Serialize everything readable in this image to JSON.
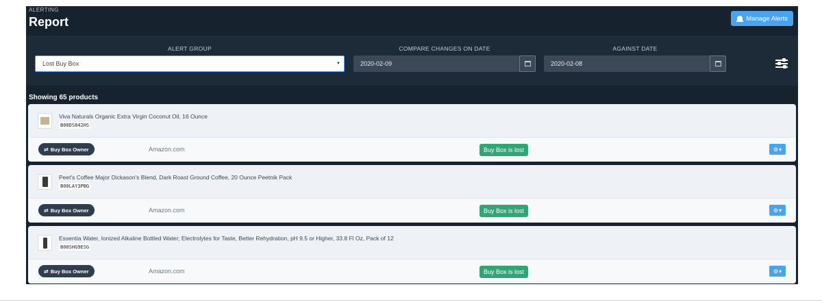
{
  "header": {
    "kicker": "ALERTING",
    "title": "Report",
    "manage_label": "Manage Alerts"
  },
  "filters": {
    "alert_group_label": "ALERT GROUP",
    "alert_group_value": "Lost Buy Box",
    "compare_label": "COMPARE CHANGES ON DATE",
    "compare_value": "2020-02-09",
    "against_label": "AGAINST DATE",
    "against_value": "2020-02-08"
  },
  "summary": {
    "showing": "Showing 65 products"
  },
  "products": [
    {
      "name": "Viva Naturals Organic Extra Virgin Coconut Oil, 16 Ounce",
      "asin": "B00DS842HS",
      "owner_label": "Buy Box Owner",
      "seller": "Amazon.com",
      "status": "Buy Box is lost"
    },
    {
      "name": "Peet's Coffee Major Dickason's Blend, Dark Roast Ground Coffee, 20 Ounce Peetnik Pack",
      "asin": "B00LAY3PBG",
      "owner_label": "Buy Box Owner",
      "seller": "Amazon.com",
      "status": "Buy Box is lost"
    },
    {
      "name": "Essentia Water, Ionized Alkaline Bottled Water; Electrolytes for Taste, Better Rehydration, pH 9.5 or Higher, 33.8 Fl Oz, Pack of 12",
      "asin": "B00SHG9ESG",
      "owner_label": "Buy Box Owner",
      "seller": "Amazon.com",
      "status": "Buy Box is lost"
    }
  ],
  "colors": {
    "accent": "#4aa3ee",
    "success": "#35a277",
    "dark": "#16232f"
  },
  "icons": {
    "manage": "bell-icon",
    "calendar": "calendar-icon",
    "settings": "sliders-icon",
    "row_menu": "gear-icon",
    "owner": "swap-icon"
  }
}
